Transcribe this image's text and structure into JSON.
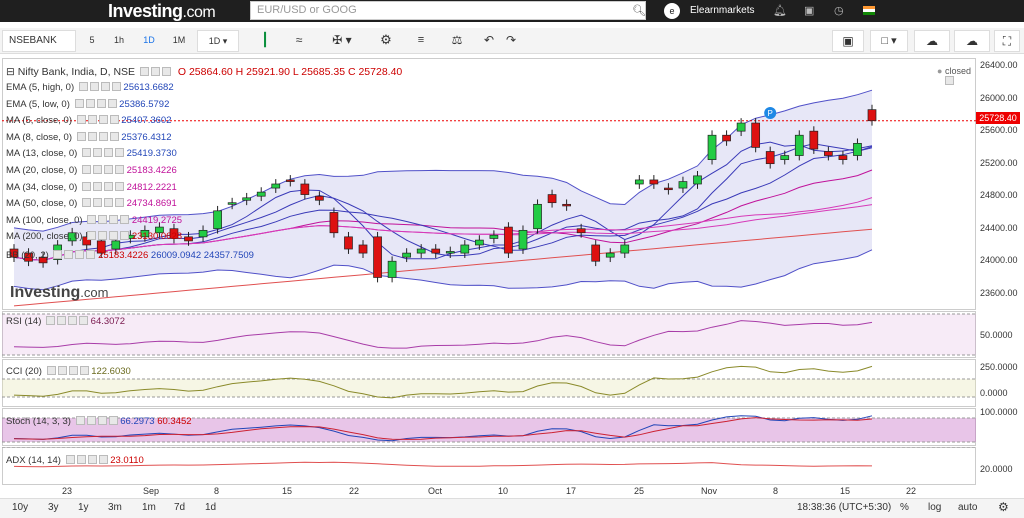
{
  "header": {
    "logo_main": "Investing",
    "logo_suffix": ".com",
    "search_placeholder": "EUR/USD or GOOG",
    "user_initial": "e",
    "user_name": "Elearnmarkets"
  },
  "toolbar": {
    "symbol": "NSEBANK",
    "intervals": [
      "5",
      "1h",
      "1D",
      "1M",
      "1D"
    ],
    "active_interval": "1D"
  },
  "main": {
    "title": "Nifty Bank, India, D, NSE",
    "ohlc": "O 25864.60  H 25921.90  L 25685.35  C 25728.40",
    "status": "closed",
    "last_price": "25728.40",
    "indicators": [
      {
        "label": "EMA (5, high, 0)",
        "value": "25613.6682"
      },
      {
        "label": "EMA (5, low, 0)",
        "value": "25386.5792"
      },
      {
        "label": "MA (5, close, 0)",
        "value": "25407.3602"
      },
      {
        "label": "MA (8, close, 0)",
        "value": "25376.4312"
      },
      {
        "label": "MA (13, close, 0)",
        "value": "25419.3730"
      },
      {
        "label": "MA (20, close, 0)",
        "value": "25183.4226"
      },
      {
        "label": "MA (34, close, 0)",
        "value": "24812.2221"
      },
      {
        "label": "MA (50, close, 0)",
        "value": "24734.8691"
      },
      {
        "label": "MA (100, close, 0)",
        "value": "24419.2725"
      },
      {
        "label": "MA (200, close, 0)",
        "value": "23130.0628"
      }
    ],
    "bb": {
      "label": "BB (20, 2)",
      "v1": "25183.4226",
      "v2": "26009.0942",
      "v3": "24357.7509"
    },
    "axis": [
      "26400.00",
      "26000.00",
      "25600.00",
      "25200.00",
      "24800.00",
      "24400.00",
      "24000.00",
      "23600.00"
    ],
    "watermark_main": "Investing",
    "watermark_suffix": ".com"
  },
  "rsi": {
    "label": "RSI (14)",
    "value": "64.3072",
    "axis": "50.0000"
  },
  "cci": {
    "label": "CCI (20)",
    "value": "122.6030",
    "axis": [
      "250.0000",
      "0.0000"
    ]
  },
  "stoch": {
    "label": "Stoch (14, 3, 3)",
    "v1": "66.2973",
    "v2": "60.3452",
    "axis": "100.0000"
  },
  "adx": {
    "label": "ADX (14, 14)",
    "value": "23.0110",
    "axis": "20.0000"
  },
  "x_axis": [
    "23",
    "Sep",
    "8",
    "15",
    "22",
    "Oct",
    "10",
    "17",
    "25",
    "Nov",
    "8",
    "15",
    "22"
  ],
  "footer": {
    "ranges": [
      "10y",
      "3y",
      "1y",
      "3m",
      "1m",
      "7d",
      "1d"
    ],
    "time": "18:38:36 (UTC+5:30)",
    "pct": "%",
    "log": "log",
    "auto": "auto"
  },
  "chart_data": {
    "type": "candlestick",
    "y_axis_ticks": [
      23600,
      24000,
      24400,
      24800,
      25200,
      25600,
      26000,
      26400
    ],
    "ylim": [
      23400,
      26500
    ],
    "candles": [
      {
        "o": 24150,
        "c": 24050
      },
      {
        "o": 24100,
        "c": 24000
      },
      {
        "o": 24050,
        "c": 23980
      },
      {
        "o": 24020,
        "c": 24200
      },
      {
        "o": 24250,
        "c": 24350
      },
      {
        "o": 24300,
        "c": 24200
      },
      {
        "o": 24250,
        "c": 24100
      },
      {
        "o": 24150,
        "c": 24250
      },
      {
        "o": 24280,
        "c": 24320
      },
      {
        "o": 24300,
        "c": 24380
      },
      {
        "o": 24350,
        "c": 24420
      },
      {
        "o": 24400,
        "c": 24280
      },
      {
        "o": 24300,
        "c": 24250
      },
      {
        "o": 24300,
        "c": 24380
      },
      {
        "o": 24400,
        "c": 24620
      },
      {
        "o": 24700,
        "c": 24720
      },
      {
        "o": 24750,
        "c": 24780
      },
      {
        "o": 24800,
        "c": 24850
      },
      {
        "o": 24900,
        "c": 24950
      },
      {
        "o": 25000,
        "c": 24980
      },
      {
        "o": 24950,
        "c": 24820
      },
      {
        "o": 24800,
        "c": 24750
      },
      {
        "o": 24600,
        "c": 24350
      },
      {
        "o": 24300,
        "c": 24150
      },
      {
        "o": 24200,
        "c": 24100
      },
      {
        "o": 24300,
        "c": 23800
      },
      {
        "o": 23800,
        "c": 24000
      },
      {
        "o": 24050,
        "c": 24100
      },
      {
        "o": 24100,
        "c": 24150
      },
      {
        "o": 24150,
        "c": 24100
      },
      {
        "o": 24100,
        "c": 24120
      },
      {
        "o": 24100,
        "c": 24200
      },
      {
        "o": 24200,
        "c": 24260
      },
      {
        "o": 24280,
        "c": 24320
      },
      {
        "o": 24420,
        "c": 24100
      },
      {
        "o": 24150,
        "c": 24380
      },
      {
        "o": 24400,
        "c": 24700
      },
      {
        "o": 24820,
        "c": 24720
      },
      {
        "o": 24700,
        "c": 24680
      },
      {
        "o": 24400,
        "c": 24350
      },
      {
        "o": 24200,
        "c": 24000
      },
      {
        "o": 24050,
        "c": 24100
      },
      {
        "o": 24100,
        "c": 24200
      },
      {
        "o": 24950,
        "c": 25000
      },
      {
        "o": 25000,
        "c": 24950
      },
      {
        "o": 24900,
        "c": 24880
      },
      {
        "o": 24900,
        "c": 24980
      },
      {
        "o": 24950,
        "c": 25050
      },
      {
        "o": 25250,
        "c": 25550
      },
      {
        "o": 25550,
        "c": 25480
      },
      {
        "o": 25600,
        "c": 25700
      },
      {
        "o": 25700,
        "c": 25400
      },
      {
        "o": 25350,
        "c": 25200
      },
      {
        "o": 25250,
        "c": 25300
      },
      {
        "o": 25300,
        "c": 25550
      },
      {
        "o": 25600,
        "c": 25380
      },
      {
        "o": 25350,
        "c": 25300
      },
      {
        "o": 25300,
        "c": 25250
      },
      {
        "o": 25300,
        "c": 25450
      },
      {
        "o": 25864.6,
        "c": 25728.4
      }
    ]
  }
}
